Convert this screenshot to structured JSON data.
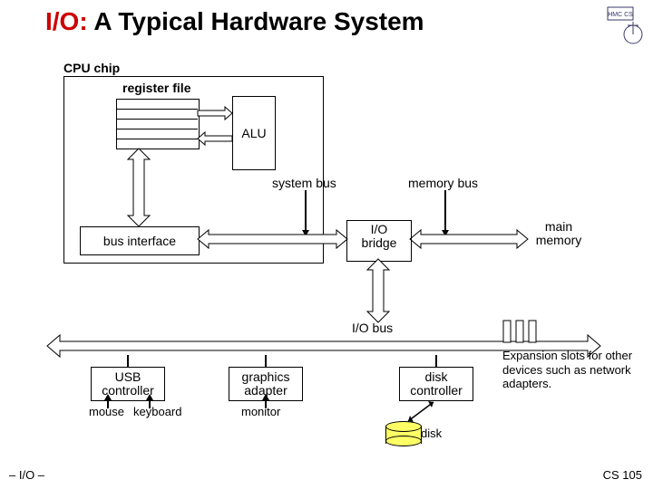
{
  "title_accent": "I/O:",
  "title_rest": " A Typical Hardware System",
  "labels": {
    "cpu": "CPU chip",
    "register_file": "register file",
    "alu": "ALU",
    "system_bus": "system bus",
    "memory_bus": "memory bus",
    "bus_interface": "bus interface",
    "io_bridge": "I/O\nbridge",
    "main_memory": "main\nmemory",
    "io_bus": "I/O bus",
    "usb": "USB\ncontroller",
    "graphics": "graphics\nadapter",
    "disk_ctrl": "disk\ncontroller",
    "mouse": "mouse",
    "keyboard": "keyboard",
    "monitor": "monitor",
    "disk": "disk",
    "expansion": "Expansion slots for other devices such as network adapters."
  },
  "footer": {
    "left": "– I/O –",
    "right": "CS 105"
  },
  "logo_text": "HMC CS"
}
